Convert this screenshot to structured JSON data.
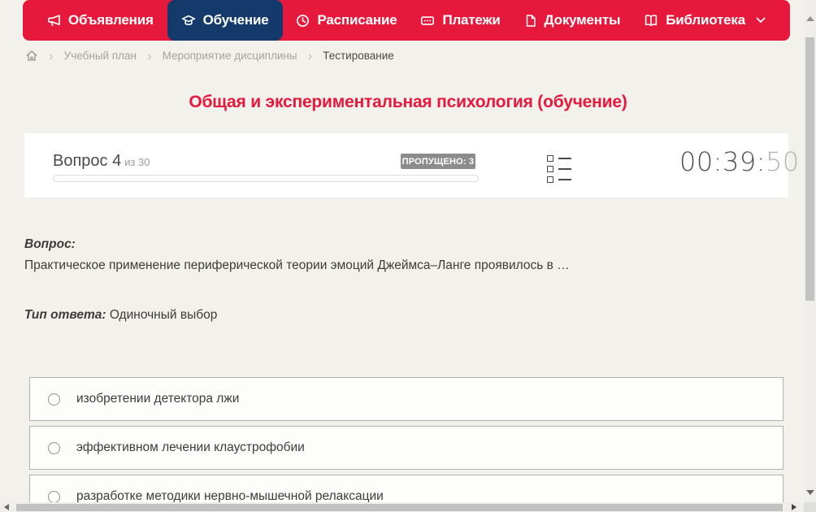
{
  "nav": {
    "items": [
      {
        "label": "Объявления",
        "icon": "megaphone-icon",
        "active": false
      },
      {
        "label": "Обучение",
        "icon": "graduation-cap-icon",
        "active": true
      },
      {
        "label": "Расписание",
        "icon": "clock-icon",
        "active": false
      },
      {
        "label": "Платежи",
        "icon": "payments-icon",
        "active": false
      },
      {
        "label": "Документы",
        "icon": "document-icon",
        "active": false
      },
      {
        "label": "Библиотека",
        "icon": "book-icon",
        "active": false,
        "has_dropdown": true
      }
    ]
  },
  "breadcrumb": {
    "home_icon": "home-icon",
    "items": [
      "Учебный план",
      "Мероприятие дисциплины",
      "Тестирование"
    ]
  },
  "page": {
    "title": "Общая и экспериментальная психология (обучение)"
  },
  "question_header": {
    "question_label": "Вопрос 4",
    "of_label": "из 30",
    "skipped_badge": "ПРОПУЩЕНО: 3",
    "progress_percent": 0,
    "timer_hm": "00:39:",
    "timer_s": "50",
    "timer_full": "00:39:50",
    "list_icon": "list-icon"
  },
  "question": {
    "label": "Вопрос:",
    "text": "Практическое применение периферической теории эмоций Джеймса–Ланге проявилось в …",
    "answer_type_label": "Тип ответа:",
    "answer_type": "Одиночный выбор",
    "options": [
      {
        "label": "изобретении детектора лжи",
        "selected": false
      },
      {
        "label": "эффективном лечении клаустрофобии",
        "selected": false
      },
      {
        "label": "разработке методики нервно-мышечной релаксации",
        "selected": false
      }
    ]
  },
  "colors": {
    "accent_red": "#e6183c",
    "active_navy": "#143a6b",
    "page_bg": "#f2f1ec",
    "card_bg": "#ffffff",
    "badge_gray": "#8c8c8c",
    "text_dark": "#3c3c3a",
    "text_gray": "#9b9b99",
    "scrollbar_thumb": "#c2c2c2"
  }
}
